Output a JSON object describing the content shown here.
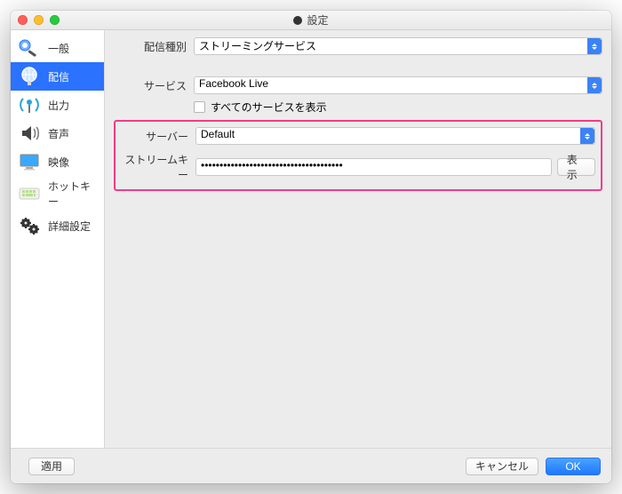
{
  "window": {
    "title": "設定"
  },
  "sidebar": {
    "items": [
      {
        "label": "一般"
      },
      {
        "label": "配信"
      },
      {
        "label": "出力"
      },
      {
        "label": "音声"
      },
      {
        "label": "映像"
      },
      {
        "label": "ホットキー"
      },
      {
        "label": "詳細設定"
      }
    ],
    "selectedIndex": 1
  },
  "form": {
    "streamTypeLabel": "配信種別",
    "streamTypeValue": "ストリーミングサービス",
    "serviceLabel": "サービス",
    "serviceValue": "Facebook Live",
    "showAllLabel": "すべてのサービスを表示",
    "serverLabel": "サーバー",
    "serverValue": "Default",
    "streamKeyLabel": "ストリームキー",
    "streamKeyValue": "••••••••••••••••••••••••••••••••••••••",
    "showButton": "表示"
  },
  "footer": {
    "apply": "適用",
    "cancel": "キャンセル",
    "ok": "OK"
  }
}
